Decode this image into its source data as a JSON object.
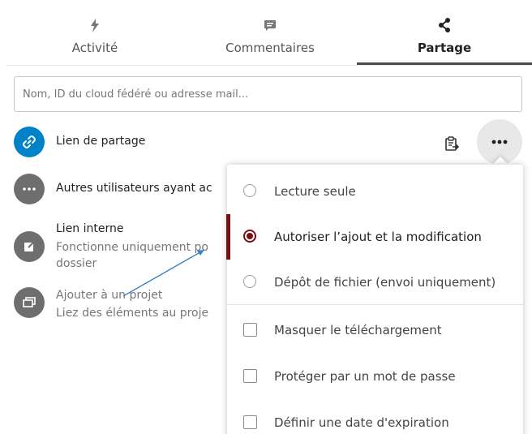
{
  "tabs": [
    {
      "label": "Activité",
      "icon": "lightning-icon",
      "active": false
    },
    {
      "label": "Commentaires",
      "icon": "comment-icon",
      "active": false
    },
    {
      "label": "Partage",
      "icon": "share-icon",
      "active": true
    }
  ],
  "search": {
    "placeholder": "Nom, ID du cloud fédéré ou adresse mail...",
    "value": ""
  },
  "entries": {
    "share_link": {
      "label": "Lien de partage",
      "icon": "link-icon",
      "color": "#0082c9"
    },
    "others_with_access": {
      "label": "Autres utilisateurs ayant ac",
      "icon": "more-icon",
      "color": "#6e6e6e"
    },
    "internal_link": {
      "title": "Lien interne",
      "sub1": "Fonctionne uniquement po",
      "sub2": "dossier",
      "icon": "external-link-icon",
      "color": "#6e6e6e"
    },
    "add_project": {
      "title": "Ajouter à un projet",
      "sub": "Liez des éléments au proje",
      "icon": "project-icon",
      "color": "#6e6e6e"
    }
  },
  "actions": {
    "clipboard_icon": "clipboard-icon",
    "menu_icon": "more-icon"
  },
  "menu": {
    "radio_items": [
      {
        "label": "Lecture seule",
        "checked": false
      },
      {
        "label": "Autoriser l’ajout et la modification",
        "checked": true
      },
      {
        "label": "Dépôt de fichier (envoi uniquement)",
        "checked": false
      }
    ],
    "checkbox_items": [
      {
        "label": "Masquer le téléchargement",
        "checked": false
      },
      {
        "label": "Protéger par un mot de passe",
        "checked": false
      },
      {
        "label": "Définir une date d'expiration",
        "checked": false
      }
    ]
  },
  "colors": {
    "accent": "#0082c9",
    "selected": "#7a0f12",
    "annotation_arrow": "#3b82c4"
  }
}
